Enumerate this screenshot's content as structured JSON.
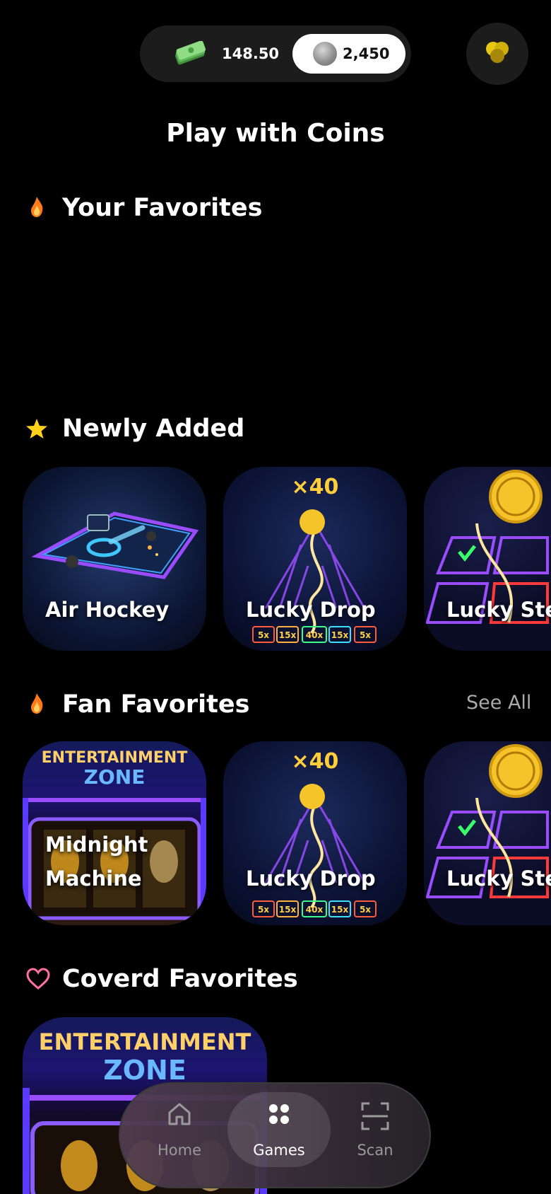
{
  "header": {
    "cash_balance": "148.50",
    "coin_balance": "2,450",
    "icons": {
      "cash": "cash-stack-icon",
      "coin": "coin-icon",
      "profile": "gold-coins-icon"
    }
  },
  "page": {
    "title": "Play with Coins"
  },
  "sections": {
    "your_favorites": {
      "title": "Your Favorites",
      "icon": "fire-icon"
    },
    "newly_added": {
      "title": "Newly Added",
      "icon": "star-icon",
      "cards": [
        {
          "label": "Air Hockey"
        },
        {
          "label": "Lucky Drop"
        },
        {
          "label": "Lucky Step"
        }
      ]
    },
    "fan_favorites": {
      "title": "Fan Favorites",
      "icon": "fire-icon",
      "see_all": "See All",
      "cards": [
        {
          "label_line1": "Midnight",
          "label_line2": "Machine"
        },
        {
          "label": "Lucky Drop"
        },
        {
          "label": "Lucky Step"
        }
      ]
    },
    "coverd_favorites": {
      "title": "Coverd Favorites",
      "icon": "heart-icon"
    }
  },
  "art_text": {
    "multiplier": "×40",
    "drop_slots": [
      "5x",
      "15x",
      "40x",
      "15x",
      "5x"
    ],
    "zone_line1": "ENTERTAINMENT",
    "zone_line2": "ZONE"
  },
  "bottom_nav": {
    "items": [
      {
        "label": "Home",
        "icon": "home-icon"
      },
      {
        "label": "Games",
        "icon": "games-grid-icon"
      },
      {
        "label": "Scan",
        "icon": "scan-icon"
      }
    ],
    "active": "Games"
  },
  "colors": {
    "background": "#000000",
    "pill": "#1c1c1c",
    "fire": "#ff7a1a",
    "star": "#ffd21a",
    "heart": "#ff6fa0",
    "neon_purple": "#9a4dff",
    "gold": "#f5c32a"
  }
}
